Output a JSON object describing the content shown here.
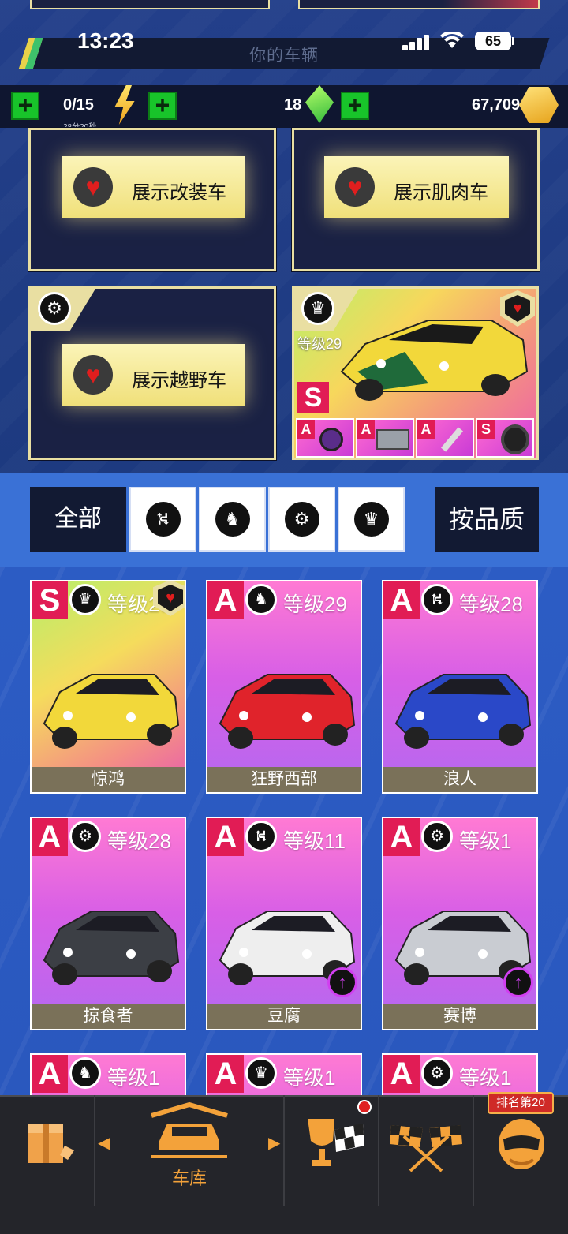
{
  "status_bar": {
    "time": "13:23",
    "battery": "65"
  },
  "header": {
    "title": "你的车辆"
  },
  "currency": {
    "energy": "0/15",
    "energy_timer": "28分20秒",
    "gems": "18",
    "gold": "67,709",
    "plus": "+"
  },
  "showcase": {
    "mod_label": "展示改装车",
    "muscle_label": "展示肌肉车",
    "offroad_label": "展示越野车",
    "featured": {
      "level": "等级29",
      "grade": "S",
      "parts": [
        "A",
        "A",
        "A",
        "S"
      ]
    }
  },
  "filters": {
    "all_label": "全部",
    "sort_label": "按品质",
    "categories": [
      {
        "icon": "road-icon",
        "glyph": "⛕"
      },
      {
        "icon": "horse-icon",
        "glyph": "♞"
      },
      {
        "icon": "wheel-icon",
        "glyph": "⚙"
      },
      {
        "icon": "crown-icon",
        "glyph": "♛"
      }
    ]
  },
  "cars": [
    {
      "grade": "S",
      "category": "crown-icon",
      "cat_glyph": "♛",
      "level": "等级29",
      "name": "惊鸿",
      "favorite": true,
      "upgrade": false,
      "color": "#f2d83a"
    },
    {
      "grade": "A",
      "category": "horse-icon",
      "cat_glyph": "♞",
      "level": "等级29",
      "name": "狂野西部",
      "favorite": false,
      "upgrade": false,
      "color": "#e0232b"
    },
    {
      "grade": "A",
      "category": "road-icon",
      "cat_glyph": "⛕",
      "level": "等级28",
      "name": "浪人",
      "favorite": false,
      "upgrade": false,
      "color": "#2a48c8"
    },
    {
      "grade": "A",
      "category": "wheel-icon",
      "cat_glyph": "⚙",
      "level": "等级28",
      "name": "掠食者",
      "favorite": false,
      "upgrade": false,
      "color": "#3c3f45"
    },
    {
      "grade": "A",
      "category": "road-icon",
      "cat_glyph": "⛕",
      "level": "等级11",
      "name": "豆腐",
      "favorite": false,
      "upgrade": true,
      "color": "#eeeeee"
    },
    {
      "grade": "A",
      "category": "wheel-icon",
      "cat_glyph": "⚙",
      "level": "等级1",
      "name": "赛博",
      "favorite": false,
      "upgrade": true,
      "color": "#c9ccd2"
    },
    {
      "grade": "A",
      "category": "horse-icon",
      "cat_glyph": "♞",
      "level": "等级1",
      "name": "",
      "favorite": false,
      "upgrade": false,
      "color": "#cccccc"
    },
    {
      "grade": "A",
      "category": "crown-icon",
      "cat_glyph": "♛",
      "level": "等级1",
      "name": "",
      "favorite": false,
      "upgrade": false,
      "color": "#cccccc"
    },
    {
      "grade": "A",
      "category": "wheel-icon",
      "cat_glyph": "⚙",
      "level": "等级1",
      "name": "",
      "favorite": false,
      "upgrade": false,
      "color": "#cccccc"
    }
  ],
  "nav": {
    "garage_label": "车库",
    "rank_badge": "排名第20"
  },
  "colors": {
    "accent_gold": "#e9dfa2",
    "grade_red": "#e11c55",
    "nav_orange": "#f3a23a"
  }
}
